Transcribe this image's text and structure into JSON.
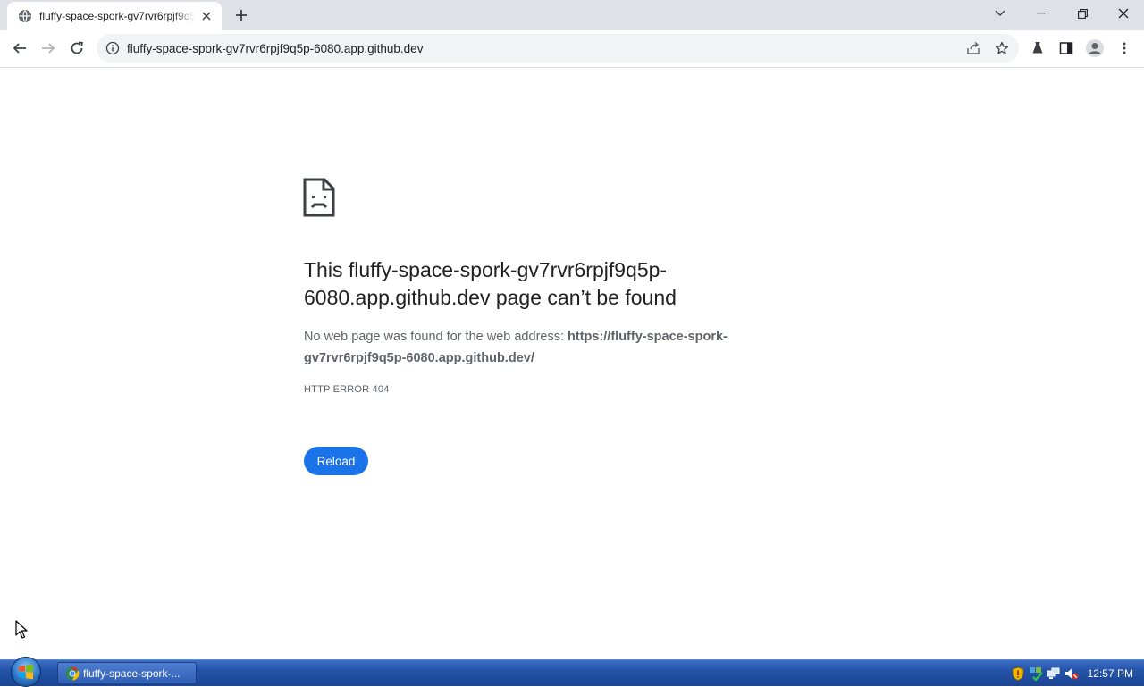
{
  "browser": {
    "tab_title": "fluffy-space-spork-gv7rvr6rpjf9q5p-6080.app.github.dev",
    "url": "fluffy-space-spork-gv7rvr6rpjf9q5p-6080.app.github.dev"
  },
  "error_page": {
    "heading": "This fluffy-space-spork-gv7rvr6rpjf9q5p-6080.app.github.dev page can’t be found",
    "description_prefix": "No web page was found for the web address: ",
    "description_url": "https://fluffy-space-spork-gv7rvr6rpjf9q5p-6080.app.github.dev/",
    "error_code": "HTTP ERROR 404",
    "reload_label": "Reload"
  },
  "taskbar": {
    "task_label": "fluffy-space-spork-...",
    "clock": "12:57 PM"
  },
  "colors": {
    "accent": "#1a73e8",
    "taskbar": "#2453a8"
  }
}
